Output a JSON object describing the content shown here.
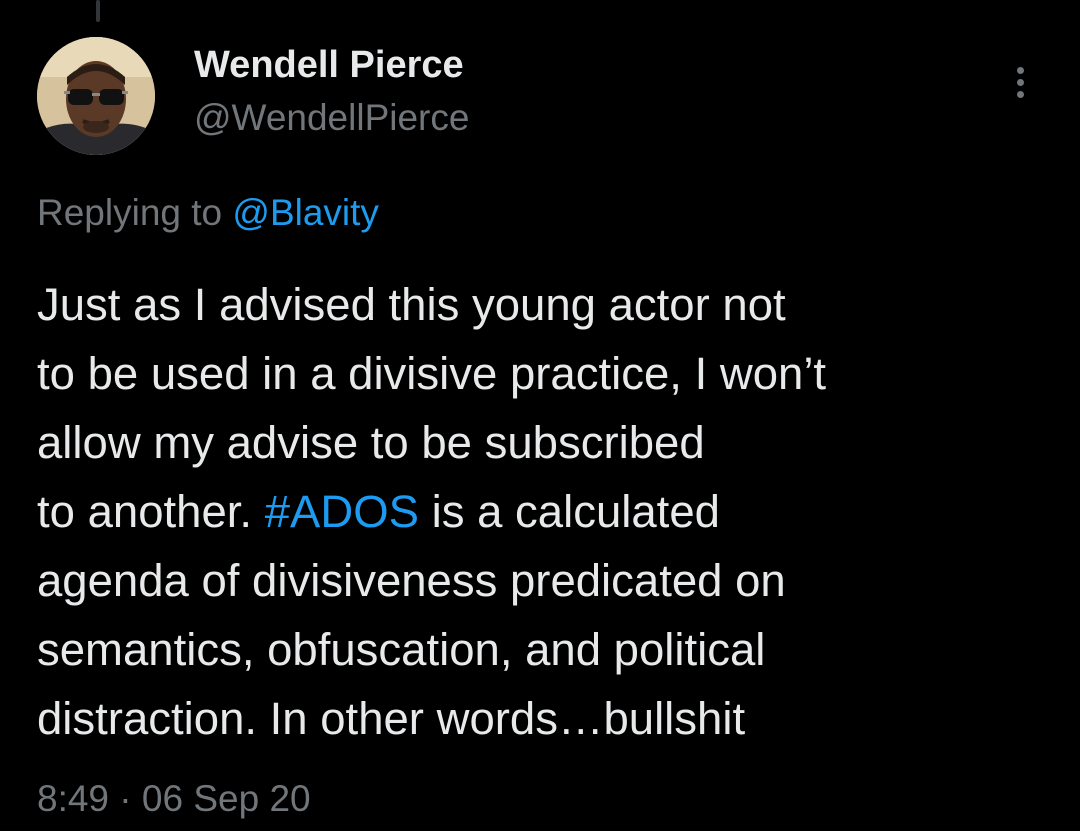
{
  "colors": {
    "background": "#000000",
    "primary_text": "#e7e9ea",
    "secondary_text": "#71767b",
    "accent": "#1d9bf0"
  },
  "tweet": {
    "author": {
      "name": "Wendell Pierce",
      "handle": "@WendellPierce",
      "avatar_icon": "profile-photo"
    },
    "more_icon": "vertical-ellipsis-icon",
    "replying": {
      "prefix": "Replying to ",
      "mention": "@Blavity"
    },
    "text": {
      "line1": "Just as I advised this young actor not",
      "line2": "to be used in a divisive practice, I won’t",
      "line3": "allow my advise to be subscribed",
      "line4_before": "to another. ",
      "hashtag": "#ADOS",
      "line4_after": " is a calculated",
      "line5": "agenda of divisiveness predicated on",
      "line6": "semantics, obfuscation, and political",
      "line7": "distraction. In other words…bullshit"
    },
    "time": "8:49",
    "separator": " · ",
    "date": "06 Sep 20"
  }
}
